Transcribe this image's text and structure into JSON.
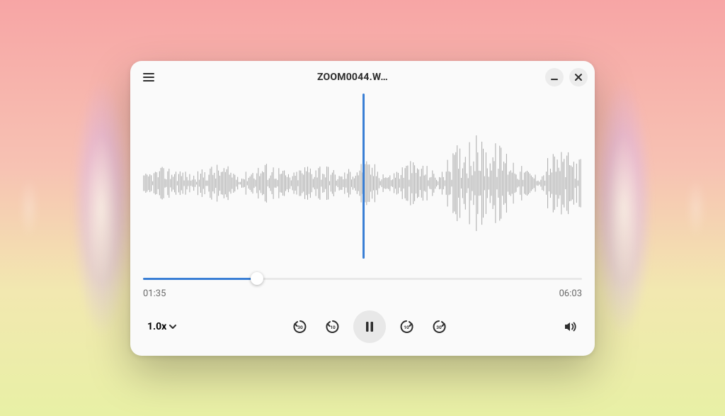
{
  "header": {
    "title": "ZOOM0044.W…"
  },
  "playback": {
    "elapsed": "01:35",
    "duration": "06:03",
    "progress_percent": 26,
    "speed_label": "1.0x"
  },
  "controls": {
    "skip_back_long": "30",
    "skip_back_short": "10",
    "skip_fwd_short": "10",
    "skip_fwd_long": "30"
  },
  "colors": {
    "accent": "#3a7fd5"
  }
}
